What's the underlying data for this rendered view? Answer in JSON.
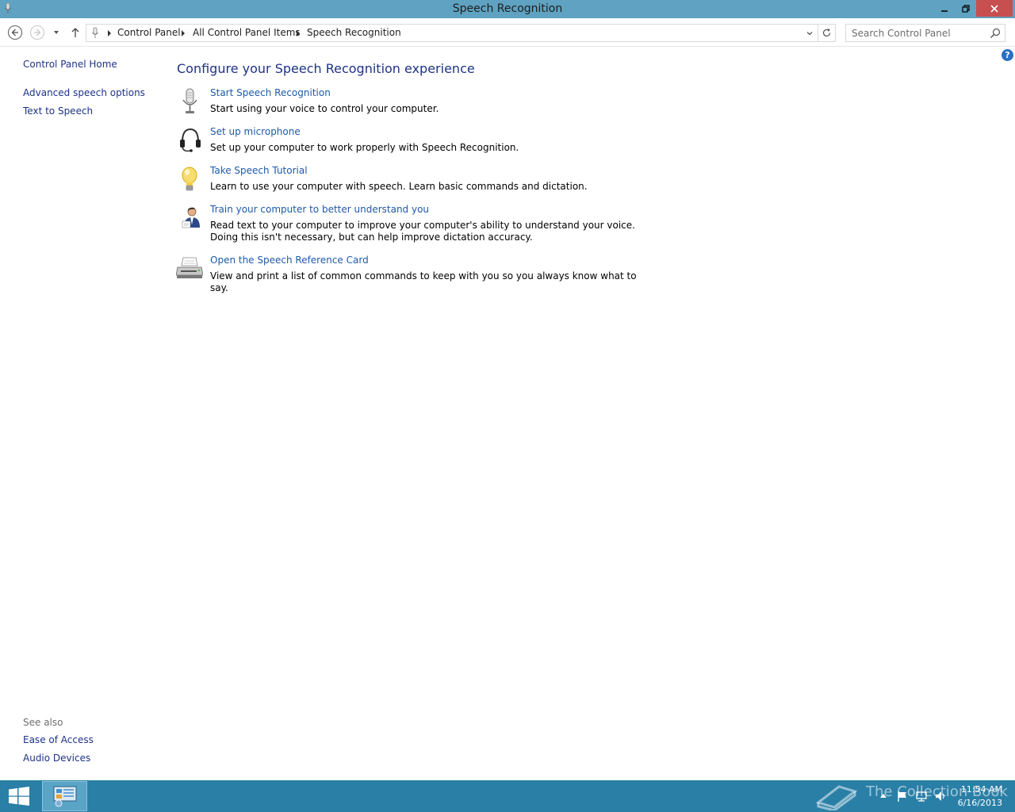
{
  "window": {
    "title": "Speech Recognition",
    "controls": {
      "minimize": "minimize-icon",
      "restore": "restore-icon",
      "close": "close-icon"
    }
  },
  "navigation": {
    "breadcrumbs": [
      "Control Panel",
      "All Control Panel Items",
      "Speech Recognition"
    ],
    "search_placeholder": "Search Control Panel"
  },
  "sidebar": {
    "home": "Control Panel Home",
    "links": [
      "Advanced speech options",
      "Text to Speech"
    ],
    "see_also_title": "See also",
    "see_also": [
      "Ease of Access",
      "Audio Devices"
    ]
  },
  "main": {
    "title": "Configure your Speech Recognition experience",
    "tasks": [
      {
        "icon": "microphone-icon",
        "link": "Start Speech Recognition",
        "description": "Start using your voice to control your computer."
      },
      {
        "icon": "headset-icon",
        "link": "Set up microphone",
        "description": "Set up your computer to work properly with Speech Recognition."
      },
      {
        "icon": "lightbulb-icon",
        "link": "Take Speech Tutorial",
        "description": "Learn to use your computer with speech.  Learn basic commands and dictation."
      },
      {
        "icon": "user-training-icon",
        "link": "Train your computer to better understand you",
        "description": "Read text to your computer to improve your computer's ability to understand your voice.  Doing this isn't necessary, but can help improve dictation accuracy."
      },
      {
        "icon": "printer-icon",
        "link": "Open the Speech Reference Card",
        "description": "View and print a list of common commands to keep with you so you always know what to say."
      }
    ]
  },
  "taskbar": {
    "watermark": "The Collection Book",
    "time": "11:54 AM",
    "date": "6/16/2013"
  },
  "colors": {
    "titlebar": "#5fa2c1",
    "close_button": "#c74f4f",
    "link": "#1e3287",
    "taskbar": "#2a7fa6"
  }
}
